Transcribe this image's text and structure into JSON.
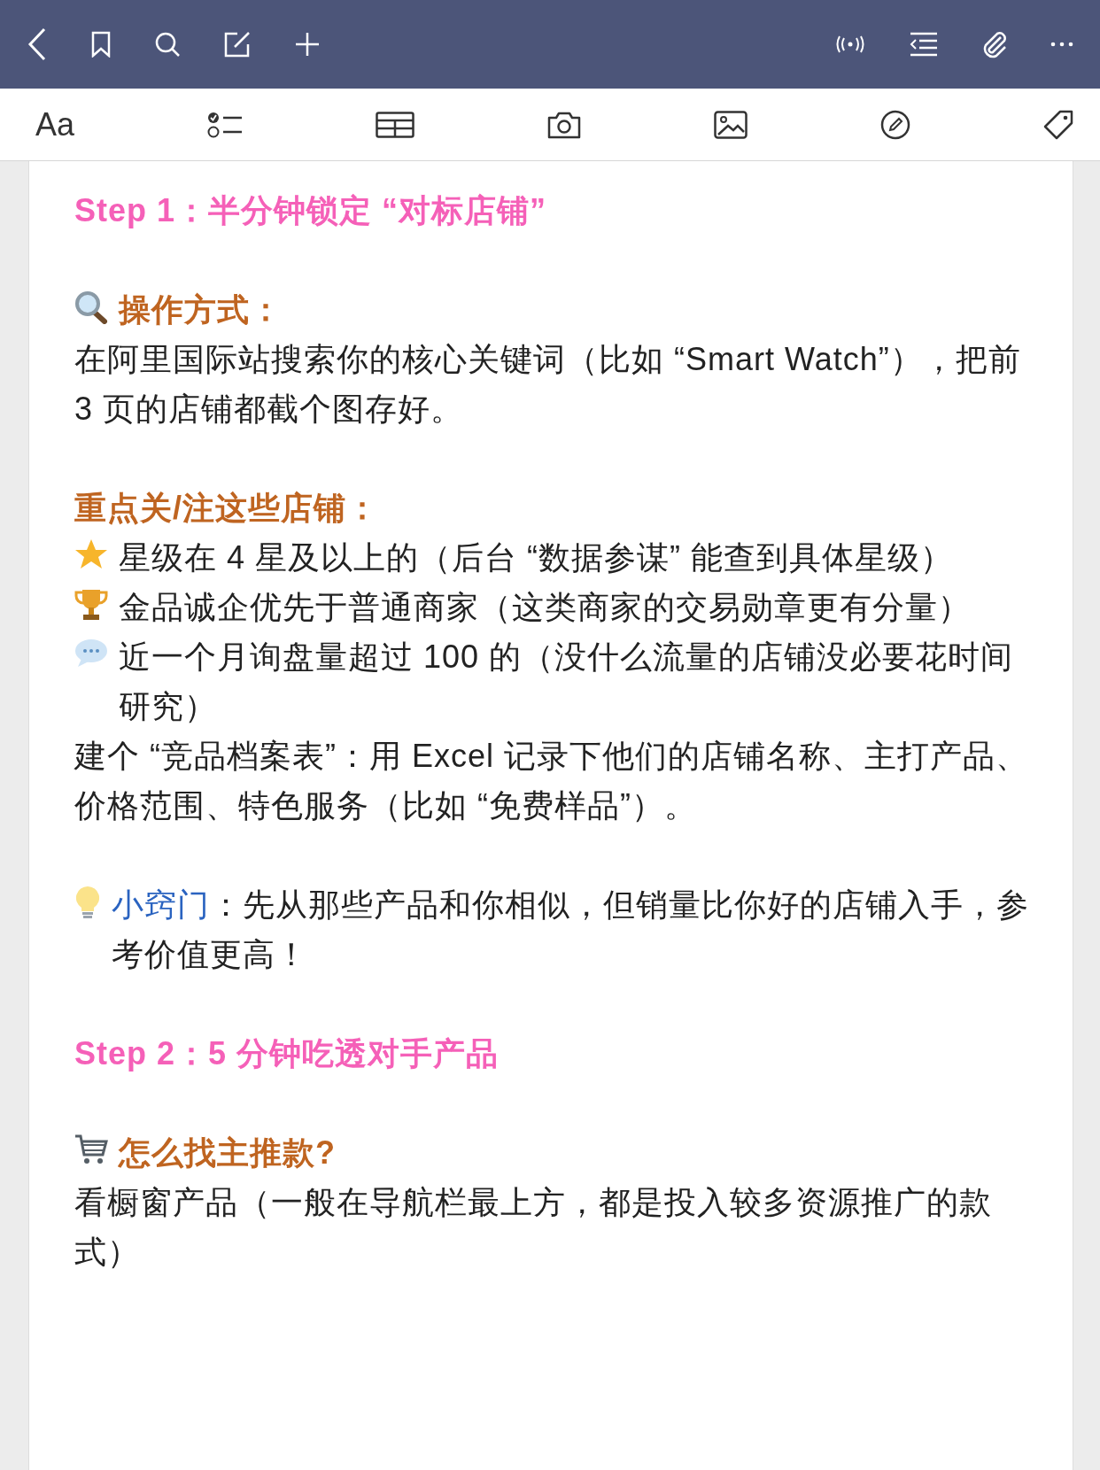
{
  "format_toolbar": {
    "font_button": "Aa"
  },
  "note": {
    "sections": [
      [
        {
          "kind": "heading",
          "text": "Step 1：半分钟锁定 “对标店铺”"
        }
      ],
      [
        {
          "kind": "search_label",
          "text": "操作方式："
        },
        {
          "kind": "paragraph",
          "text": "在阿里国际站搜索你的核心关键词（比如 “Smart Watch”），把前 3 页的店铺都截个图存好。"
        }
      ],
      [
        {
          "kind": "label",
          "text": "重点关/注这些店铺："
        },
        {
          "kind": "star_item",
          "text": "星级在 4 星及以上的（后台 “数据参谋” 能查到具体星级）"
        },
        {
          "kind": "trophy_item",
          "text": "金品诚企优先于普通商家（这类商家的交易勋章更有分量）"
        },
        {
          "kind": "chat_item",
          "text": "近一个月询盘量超过 100 的（没什么流量的店铺没必要花时间研究）"
        },
        {
          "kind": "paragraph",
          "text": "建个 “竞品档案表”：用 Excel 记录下他们的店铺名称、主打产品、价格范围、特色服务（比如 “免费样品”）。"
        }
      ],
      [
        {
          "kind": "tip",
          "tip_label": "小窍门",
          "text": "：先从那些产品和你相似，但销量比你好的店铺入手，参考价值更高！"
        }
      ],
      [
        {
          "kind": "heading",
          "text": "Step 2：5 分钟吃透对手产品"
        }
      ],
      [
        {
          "kind": "cart_label",
          "text": "怎么找主推款?"
        },
        {
          "kind": "paragraph",
          "text": "看橱窗产品（一般在导航栏最上方，都是投入较多资源推广的款式）"
        }
      ]
    ]
  }
}
